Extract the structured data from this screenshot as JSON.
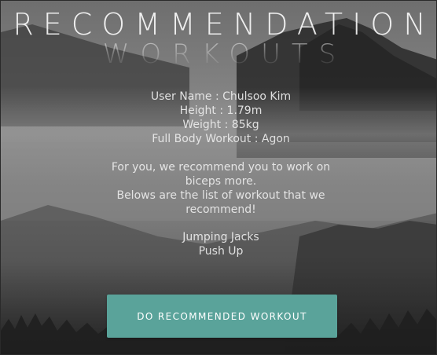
{
  "header": {
    "title_line1": "RECOMMENDATION",
    "title_line2": "WORKOUTS"
  },
  "profile": {
    "user_name": "User Name : Chulsoo Kim",
    "height": "Height : 1.79m",
    "weight": "Weight : 85kg",
    "full_body_workout": "Full Body Workout : Agon"
  },
  "recommendation": {
    "line1": "For you, we recommend you to work on",
    "line2": "biceps more.",
    "line3": "Belows are the list of workout that we",
    "line4": "recommend!"
  },
  "workouts": [
    "Jumping Jacks",
    "Push Up"
  ],
  "action": {
    "button_label": "DO RECOMMENDED WORKOUT"
  },
  "colors": {
    "button": "#5aa39a",
    "text": "#ebebeb"
  }
}
